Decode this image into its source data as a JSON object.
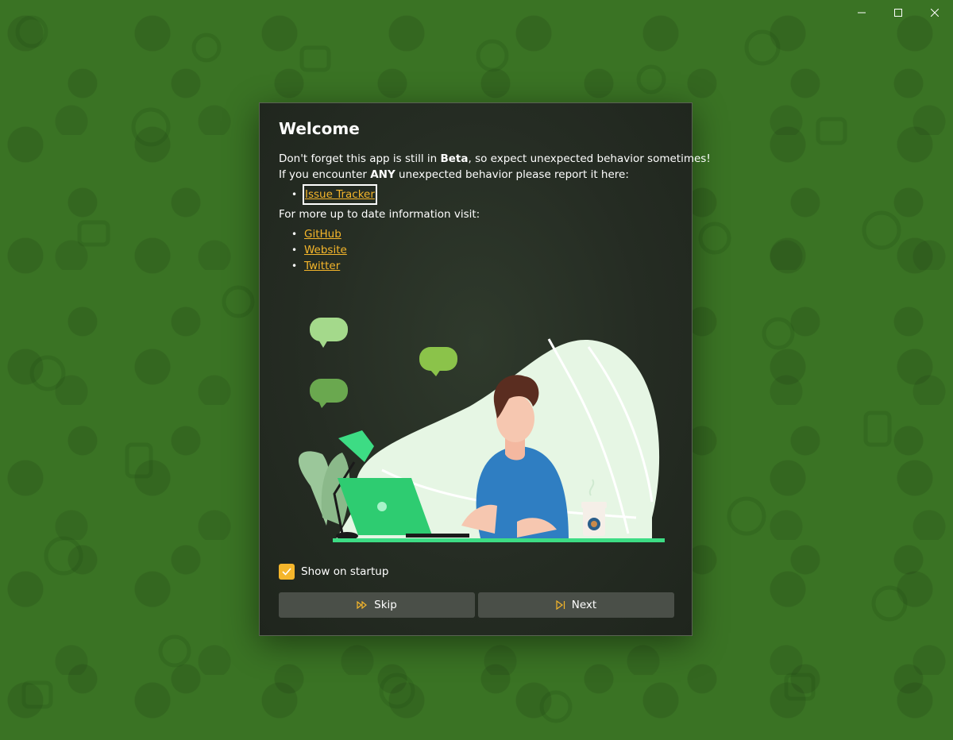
{
  "window": {
    "controls": {
      "minimize_icon": "minimize-icon",
      "maximize_icon": "maximize-icon",
      "close_icon": "close-icon"
    }
  },
  "dialog": {
    "title": "Welcome",
    "line1": {
      "pre": "Don't forget this app is still in ",
      "bold": "Beta",
      "post": ", so expect unexpected behavior sometimes!"
    },
    "line2": {
      "pre": "If you encounter ",
      "bold": "ANY",
      "post": " unexpected behavior please report it here:"
    },
    "report_links": [
      {
        "label": "Issue Tracker"
      }
    ],
    "line3": "For more up to date information visit:",
    "info_links": [
      {
        "label": "GitHub"
      },
      {
        "label": "Website"
      },
      {
        "label": "Twitter"
      }
    ],
    "show_on_startup": {
      "label": "Show on startup",
      "checked": true
    },
    "buttons": {
      "skip": {
        "label": "Skip",
        "icon": "fast-forward-icon"
      },
      "next": {
        "label": "Next",
        "icon": "skip-next-icon"
      }
    }
  },
  "colors": {
    "accent": "#f5b62b",
    "background": "#3a7324",
    "dialog_bg": "#252c23",
    "button_bg": "#4a4f48"
  }
}
